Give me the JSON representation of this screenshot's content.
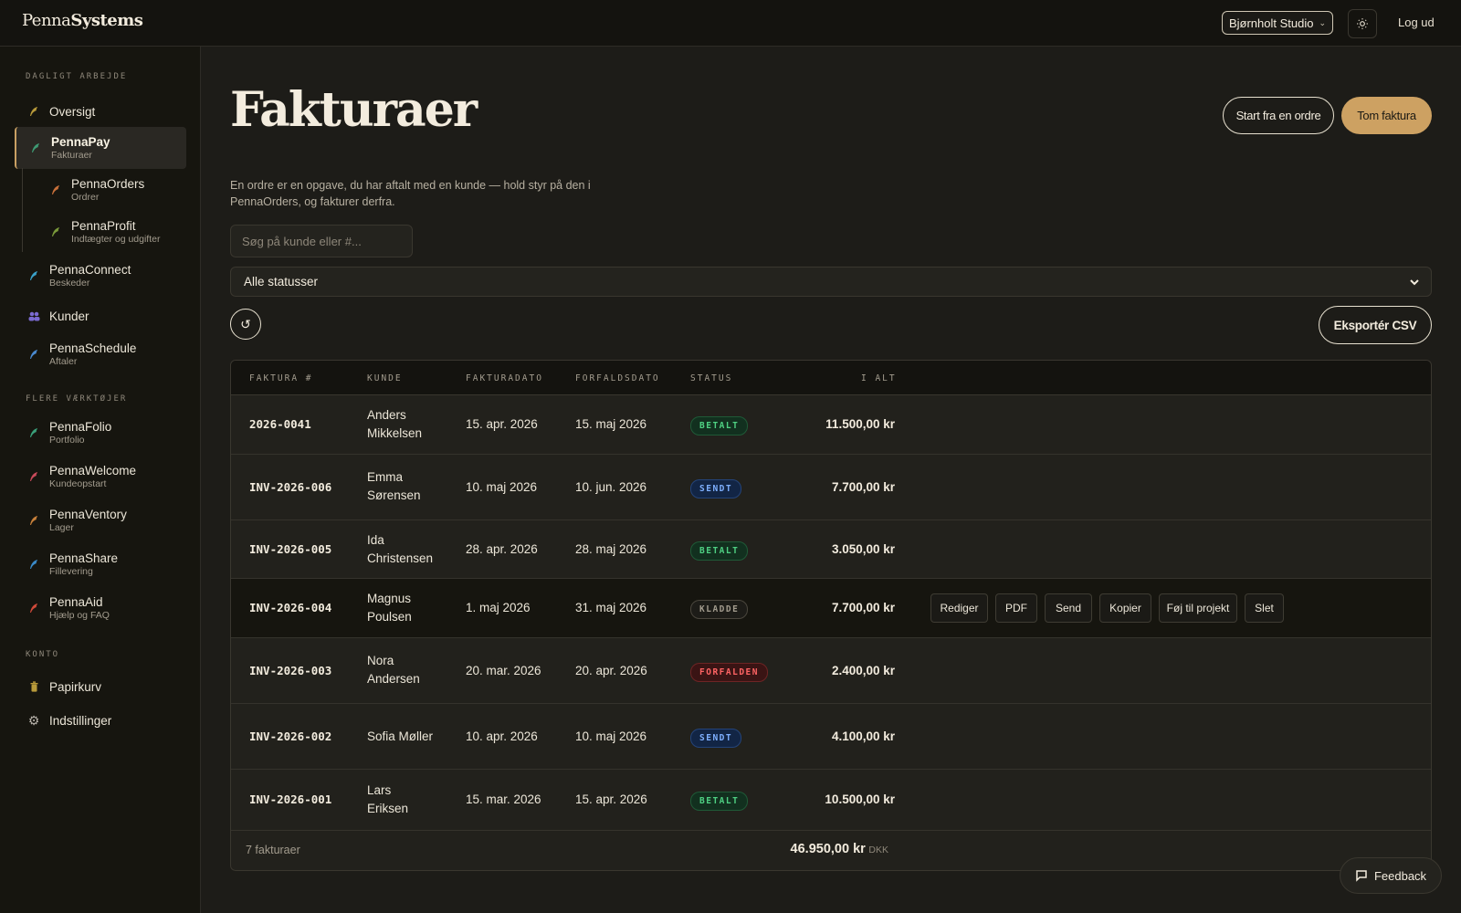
{
  "header": {
    "logo_light": "Penna",
    "logo_bold": "Systems",
    "studio": "Bjørnholt Studio",
    "logout": "Log ud"
  },
  "sidebar": {
    "section_daily": "DAGLIGT ARBEJDE",
    "section_more": "FLERE VÆRKTØJER",
    "section_account": "KONTO",
    "items": [
      {
        "title": "Oversigt",
        "sub": "",
        "color": "#b89a3a"
      },
      {
        "title": "PennaPay",
        "sub": "Fakturaer",
        "color": "#3e9a73"
      },
      {
        "title": "PennaOrders",
        "sub": "Ordrer",
        "color": "#c8703a"
      },
      {
        "title": "PennaProfit",
        "sub": "Indtægter og udgifter",
        "color": "#7a9a3a"
      },
      {
        "title": "PennaConnect",
        "sub": "Beskeder",
        "color": "#3aa0c8"
      },
      {
        "title": "Kunder",
        "sub": "",
        "color": "#7a6ad0"
      },
      {
        "title": "PennaSchedule",
        "sub": "Aftaler",
        "color": "#4a8ad0"
      },
      {
        "title": "PennaFolio",
        "sub": "Portfolio",
        "color": "#3aa07a"
      },
      {
        "title": "PennaWelcome",
        "sub": "Kundeopstart",
        "color": "#c84a5a"
      },
      {
        "title": "PennaVentory",
        "sub": "Lager",
        "color": "#c8803a"
      },
      {
        "title": "PennaShare",
        "sub": "Fillevering",
        "color": "#3a8ac8"
      },
      {
        "title": "PennaAid",
        "sub": "Hjælp og FAQ",
        "color": "#d04a3a"
      },
      {
        "title": "Papirkurv",
        "sub": "",
        "color": "#b89a3a"
      },
      {
        "title": "Indstillinger",
        "sub": "",
        "color": "#9a9590"
      }
    ]
  },
  "main": {
    "title": "Fakturaer",
    "btn_from_order": "Start fra en ordre",
    "btn_empty": "Tom faktura",
    "intro": "En ordre er en opgave, du har aftalt med en kunde — hold styr på den i PennaOrders, og fakturer derfra.",
    "search_placeholder": "Søg på kunde eller #...",
    "status_filter": "Alle statusser",
    "export": "Eksportér CSV"
  },
  "table": {
    "headers": [
      "FAKTURA #",
      "KUNDE",
      "FAKTURADATO",
      "FORFALDSDATO",
      "STATUS",
      "I ALT"
    ],
    "rows": [
      {
        "num": "2026-0041",
        "customer1": "Anders",
        "customer2": "Mikkelsen",
        "date": "15. apr. 2026",
        "due": "15. maj 2026",
        "status": "BETALT",
        "total": "11.500,00 kr"
      },
      {
        "num": "INV-2026-006",
        "customer1": "Emma",
        "customer2": "Sørensen",
        "date": "10. maj 2026",
        "due": "10. jun. 2026",
        "status": "SENDT",
        "total": "7.700,00 kr"
      },
      {
        "num": "INV-2026-005",
        "customer1": "Ida",
        "customer2": "Christensen",
        "date": "28. apr. 2026",
        "due": "28. maj 2026",
        "status": "BETALT",
        "total": "3.050,00 kr"
      },
      {
        "num": "INV-2026-004",
        "customer1": "Magnus",
        "customer2": "Poulsen",
        "date": "1. maj 2026",
        "due": "31. maj 2026",
        "status": "KLADDE",
        "total": "7.700,00 kr"
      },
      {
        "num": "INV-2026-003",
        "customer1": "Nora",
        "customer2": "Andersen",
        "date": "20. mar. 2026",
        "due": "20. apr. 2026",
        "status": "FORFALDEN",
        "total": "2.400,00 kr"
      },
      {
        "num": "INV-2026-002",
        "customer1": "Sofia Møller",
        "customer2": "",
        "date": "10. apr. 2026",
        "due": "10. maj 2026",
        "status": "SENDT",
        "total": "4.100,00 kr"
      },
      {
        "num": "INV-2026-001",
        "customer1": "Lars",
        "customer2": "Eriksen",
        "date": "15. mar. 2026",
        "due": "15. apr. 2026",
        "status": "BETALT",
        "total": "10.500,00 kr"
      }
    ],
    "actions": [
      "Rediger",
      "PDF",
      "Send",
      "Kopier",
      "Føj til projekt",
      "Slet"
    ],
    "count": "7 fakturaer",
    "total": "46.950,00 kr",
    "currency": "DKK"
  },
  "feedback": "Feedback"
}
